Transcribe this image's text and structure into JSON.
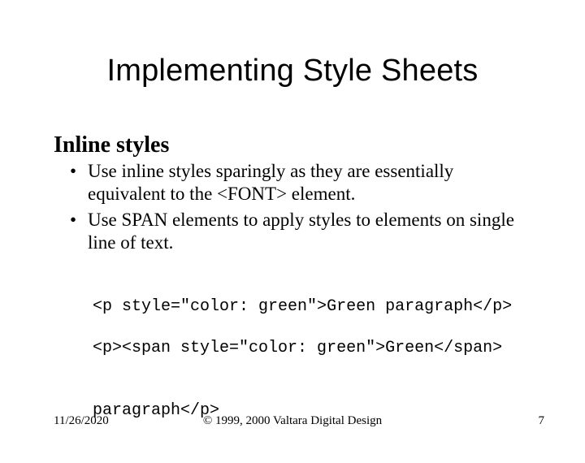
{
  "title": "Implementing Style Sheets",
  "subhead": "Inline styles",
  "bullets": [
    "Use inline styles sparingly as they are essentially equivalent to the <FONT> element.",
    "Use SPAN elements to apply styles to elements on single line of text."
  ],
  "code": {
    "line1": "<p style=\"color: green\">Green paragraph</p>",
    "line2": "<p><span style=\"color: green\">Green</span>",
    "line3": "paragraph</p>"
  },
  "footer": {
    "date": "11/26/2020",
    "copyright": "© 1999, 2000 Valtara Digital Design",
    "page": "7"
  }
}
